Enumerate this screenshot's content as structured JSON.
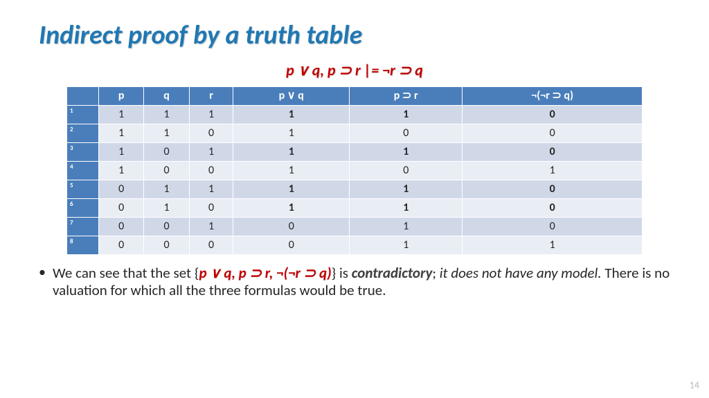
{
  "title": "Indirect proof by a truth table",
  "subtitle": "p ∨ q, p ⊃ r |= ¬r ⊃ q",
  "table": {
    "headers": [
      "",
      "p",
      "q",
      "r",
      "p ∨ q",
      "p ⊃ r",
      "¬(¬r ⊃ q)"
    ],
    "rows": [
      {
        "n": "1",
        "cells": [
          "1",
          "1",
          "1",
          "1",
          "1",
          "0"
        ],
        "bold": [
          false,
          false,
          false,
          true,
          true,
          true
        ]
      },
      {
        "n": "2",
        "cells": [
          "1",
          "1",
          "0",
          "1",
          "0",
          "0"
        ],
        "bold": [
          false,
          false,
          false,
          false,
          false,
          false
        ]
      },
      {
        "n": "3",
        "cells": [
          "1",
          "0",
          "1",
          "1",
          "1",
          "0"
        ],
        "bold": [
          false,
          false,
          false,
          true,
          true,
          true
        ]
      },
      {
        "n": "4",
        "cells": [
          "1",
          "0",
          "0",
          "1",
          "0",
          "1"
        ],
        "bold": [
          false,
          false,
          false,
          false,
          false,
          false
        ]
      },
      {
        "n": "5",
        "cells": [
          "0",
          "1",
          "1",
          "1",
          "1",
          "0"
        ],
        "bold": [
          false,
          false,
          false,
          true,
          true,
          true
        ]
      },
      {
        "n": "6",
        "cells": [
          "0",
          "1",
          "0",
          "1",
          "1",
          "0"
        ],
        "bold": [
          false,
          false,
          false,
          true,
          true,
          true
        ]
      },
      {
        "n": "7",
        "cells": [
          "0",
          "0",
          "1",
          "0",
          "1",
          "0"
        ],
        "bold": [
          false,
          false,
          false,
          false,
          false,
          false
        ]
      },
      {
        "n": "8",
        "cells": [
          "0",
          "0",
          "0",
          "0",
          "1",
          "1"
        ],
        "bold": [
          false,
          false,
          false,
          false,
          false,
          false
        ]
      }
    ]
  },
  "bullet": {
    "lead": "We can see that the set {",
    "set": "p ∨ q, p ⊃ r, ¬(¬r ⊃ q)",
    "after_set": "} is ",
    "contradictory": "contradictory",
    "semic": "; ",
    "no_model": "it does not have any model.",
    "tail": " There is no valuation for which all the three formulas would be true."
  },
  "page_number": "14"
}
